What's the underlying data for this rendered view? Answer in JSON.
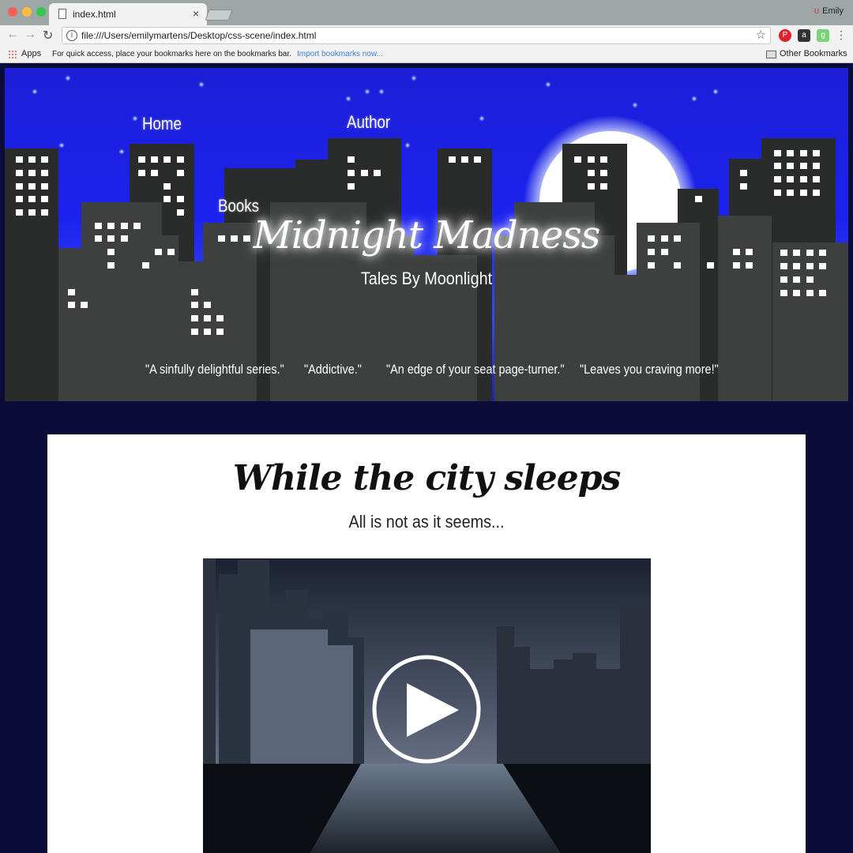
{
  "browser": {
    "tab_title": "index.html",
    "tab_close": "×",
    "profile_name": "Emily",
    "url": "file:///Users/emilymartens/Desktop/css-scene/index.html",
    "bookmarks": {
      "apps_label": "Apps",
      "hint": "For quick access, place your bookmarks here on the bookmarks bar.",
      "import_link": "Import bookmarks now...",
      "other": "Other Bookmarks"
    }
  },
  "hero": {
    "nav": {
      "home": "Home",
      "books": "Books",
      "author": "Author"
    },
    "title": "Midnight Madness",
    "subtitle": "Tales By Moonlight",
    "quotes": [
      "\"A sinfully delightful series.\"",
      "\"Addictive.\"",
      "\"An edge of your seat page-turner.\"",
      "\"Leaves you craving more!\""
    ]
  },
  "content": {
    "title": "While the city sleeps",
    "subtitle": "All is not as it seems...",
    "video_icon": "play-icon"
  },
  "colors": {
    "sky": "#1c22ee",
    "page_bg": "#0b0d38",
    "building_dark": "#2a2b2b",
    "building_light": "#3e4040",
    "moon": "#ffffff"
  }
}
